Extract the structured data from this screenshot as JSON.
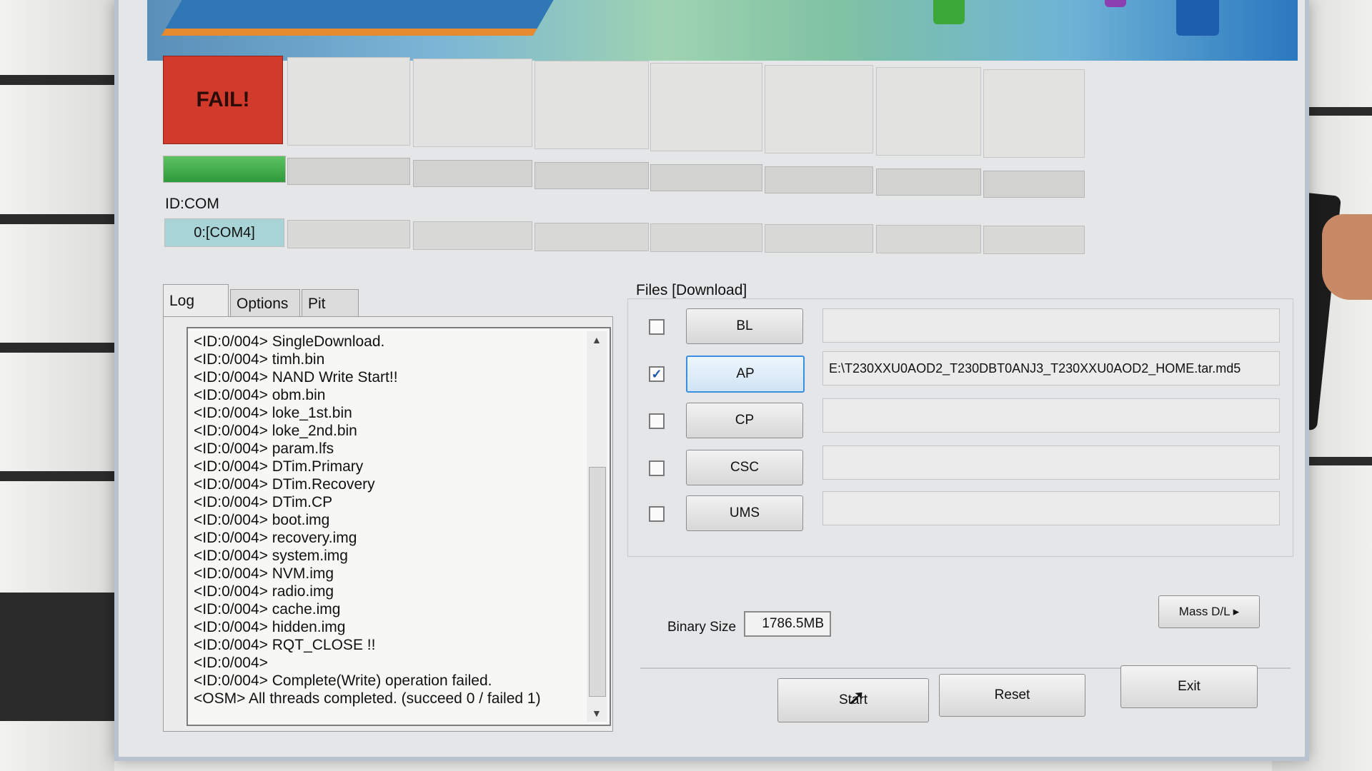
{
  "status_tiles": {
    "slot0": "FAIL!"
  },
  "progress": {
    "slot0_fraction": 1.0
  },
  "idcom": {
    "label": "ID:COM",
    "ports": [
      "0:[COM4]",
      "",
      "",
      "",
      "",
      "",
      "",
      ""
    ]
  },
  "tabs": [
    {
      "label": "Log",
      "selected": true
    },
    {
      "label": "Options",
      "selected": false
    },
    {
      "label": "Pit",
      "selected": false
    }
  ],
  "log": {
    "lines": [
      "<ID:0/004> SingleDownload.",
      "<ID:0/004> timh.bin",
      "<ID:0/004> NAND Write Start!!",
      "<ID:0/004> obm.bin",
      "<ID:0/004> loke_1st.bin",
      "<ID:0/004> loke_2nd.bin",
      "<ID:0/004> param.lfs",
      "<ID:0/004> DTim.Primary",
      "<ID:0/004> DTim.Recovery",
      "<ID:0/004> DTim.CP",
      "<ID:0/004> boot.img",
      "<ID:0/004> recovery.img",
      "<ID:0/004> system.img",
      "<ID:0/004> NVM.img",
      "<ID:0/004> radio.img",
      "<ID:0/004> cache.img",
      "<ID:0/004> hidden.img",
      "<ID:0/004> RQT_CLOSE !!",
      "<ID:0/004>",
      "<ID:0/004> Complete(Write) operation failed.",
      "<OSM> All threads completed. (succeed 0 / failed 1)"
    ]
  },
  "files": {
    "label": "Files [Download]",
    "rows": [
      {
        "button": "BL",
        "checked": false,
        "path": ""
      },
      {
        "button": "AP",
        "checked": true,
        "path": "E:\\T230XXU0AOD2_T230DBT0ANJ3_T230XXU0AOD2_HOME.tar.md5"
      },
      {
        "button": "CP",
        "checked": false,
        "path": ""
      },
      {
        "button": "CSC",
        "checked": false,
        "path": ""
      },
      {
        "button": "UMS",
        "checked": false,
        "path": ""
      }
    ]
  },
  "binary_size": {
    "label": "Binary Size",
    "value": "1786.5MB"
  },
  "buttons": {
    "mass_dl": "Mass D/L ▸",
    "start": "Start",
    "reset": "Reset",
    "exit": "Exit"
  },
  "colors": {
    "fail": "#d23a2c",
    "progress": "#3aa845",
    "com_active": "#a8d4d8",
    "ap_selected": "#3a8ee0"
  },
  "icons": {
    "cursor": "mouse-pointer-icon",
    "scroll_up": "scroll-up-arrow-icon",
    "scroll_down": "scroll-down-arrow-icon"
  }
}
